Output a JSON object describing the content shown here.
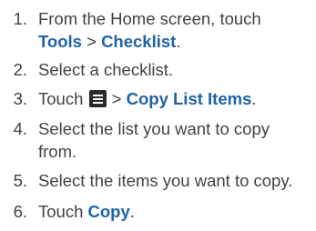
{
  "steps": [
    {
      "number": "1.",
      "line1": "From the Home screen, touch",
      "line2_kw1": "Tools",
      "line2_sep": " > ",
      "line2_kw2": "Checklist",
      "line2_end": "."
    },
    {
      "number": "2.",
      "text": "Select a checklist."
    },
    {
      "number": "3.",
      "pre": "Touch ",
      "icon": "menu-icon",
      "sep": " > ",
      "kw": "Copy List Items",
      "end": "."
    },
    {
      "number": "4.",
      "line1": "Select the list you want to copy",
      "line2": "from."
    },
    {
      "number": "5.",
      "text": "Select the items you want to copy."
    },
    {
      "number": "6.",
      "pre": "Touch ",
      "kw": "Copy",
      "end": "."
    }
  ]
}
